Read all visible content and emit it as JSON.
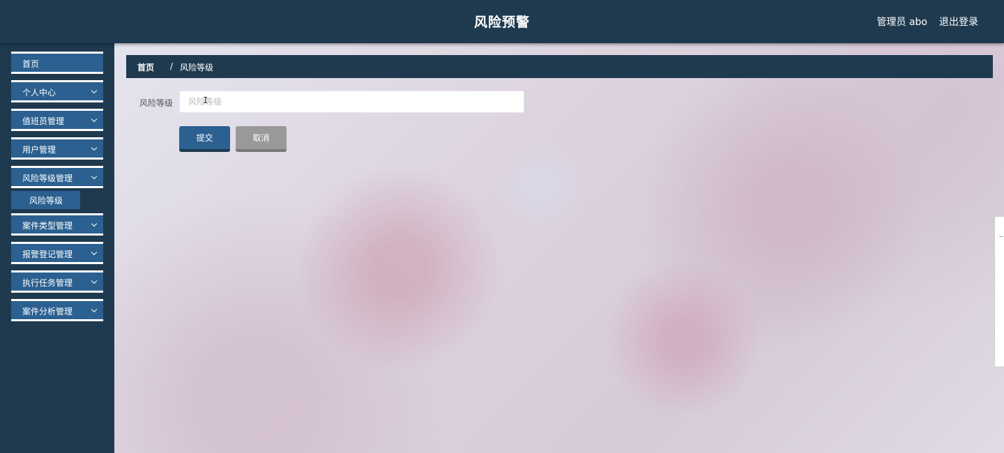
{
  "header": {
    "title": "风险预警",
    "user_label": "管理员 abo",
    "logout_label": "退出登录"
  },
  "sidebar": {
    "items": [
      {
        "label": "首页",
        "has_chevron": false
      },
      {
        "label": "个人中心",
        "has_chevron": true
      },
      {
        "label": "值班员管理",
        "has_chevron": true
      },
      {
        "label": "用户管理",
        "has_chevron": true
      },
      {
        "label": "风险等级管理",
        "has_chevron": true,
        "expanded": true,
        "children": [
          {
            "label": "风险等级",
            "active": true
          }
        ]
      },
      {
        "label": "案件类型管理",
        "has_chevron": true
      },
      {
        "label": "报警登记管理",
        "has_chevron": true
      },
      {
        "label": "执行任务管理",
        "has_chevron": true
      },
      {
        "label": "案件分析管理",
        "has_chevron": true
      }
    ],
    "icons": {
      "chevron": "chevron-down-icon"
    }
  },
  "breadcrumb": {
    "home": "首页",
    "separator": "/",
    "current": "风险等级"
  },
  "form": {
    "field_label": "风险等级",
    "field_placeholder": "风险等级",
    "field_value": "",
    "submit_label": "提交",
    "cancel_label": "取消"
  },
  "colors": {
    "header_bg": "#1f3a4f",
    "nav_item_bg": "#2b6090",
    "cancel_bg": "#999999"
  }
}
